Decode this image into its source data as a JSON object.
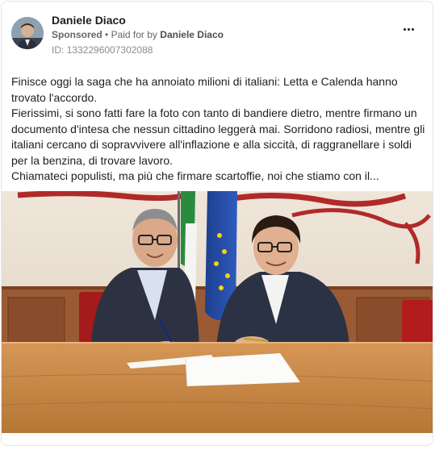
{
  "post": {
    "author": "Daniele Diaco",
    "sponsored_label": "Sponsored",
    "separator": "•",
    "paid_for_label": "Paid for by",
    "paid_for_name": "Daniele Diaco",
    "ad_id": "ID: 1332296007302088",
    "more_icon": "more-horizontal-icon",
    "text_lines": [
      "Finisce oggi la saga che ha annoiato milioni di italiani: Letta e Calenda hanno trovato l'accordo.",
      "Fierissimi, si sono fatti fare la foto con tanto di bandiere dietro, mentre firmano un documento d'intesa che nessun cittadino leggerà mai. Sorridono radiosi, mentre gli italiani cercano di sopravvivere all'inflazione e alla siccità, di raggranellare i soldi per la benzina, di trovare lavoro.",
      "Chiamateci populisti, ma più che firmare scartoffie, noi che stiamo con il..."
    ]
  },
  "colors": {
    "secondary_text": "#65676b",
    "border": "#e4e6eb",
    "wall": "#ece3d6",
    "table": "#c98a4a"
  }
}
